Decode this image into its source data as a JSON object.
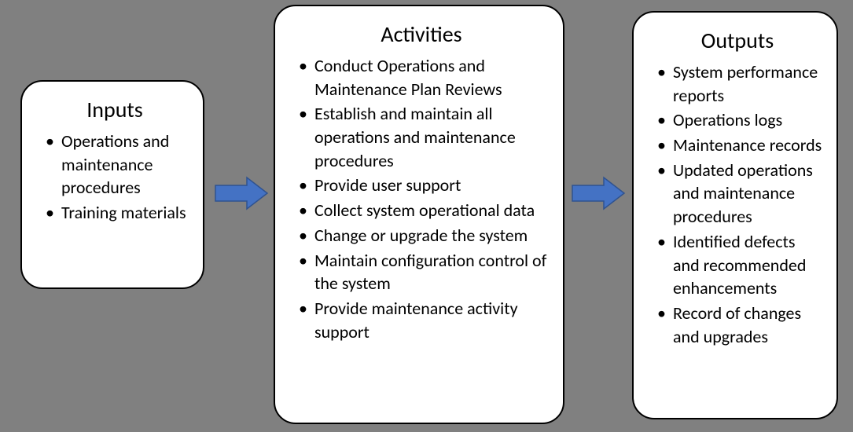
{
  "colors": {
    "arrow_fill": "#4472C4",
    "arrow_stroke": "#2F528F",
    "box_bg": "#FFFFFF",
    "box_border": "#000000",
    "page_bg": "#808080"
  },
  "inputs": {
    "title": "Inputs",
    "items": [
      "Operations and maintenance procedures",
      "Training materials"
    ]
  },
  "activities": {
    "title": "Activities",
    "items": [
      "Conduct Operations and Maintenance Plan Reviews",
      "Establish and maintain all operations and maintenance procedures",
      "Provide user support",
      "Collect system operational data",
      "Change or upgrade the system",
      "Maintain configuration control of the system",
      "Provide maintenance activity support"
    ]
  },
  "outputs": {
    "title": "Outputs",
    "items": [
      "System performance reports",
      "Operations logs",
      "Maintenance records",
      "Updated operations and maintenance procedures",
      "Identified defects and recommended enhancements",
      "Record of changes and upgrades"
    ]
  }
}
